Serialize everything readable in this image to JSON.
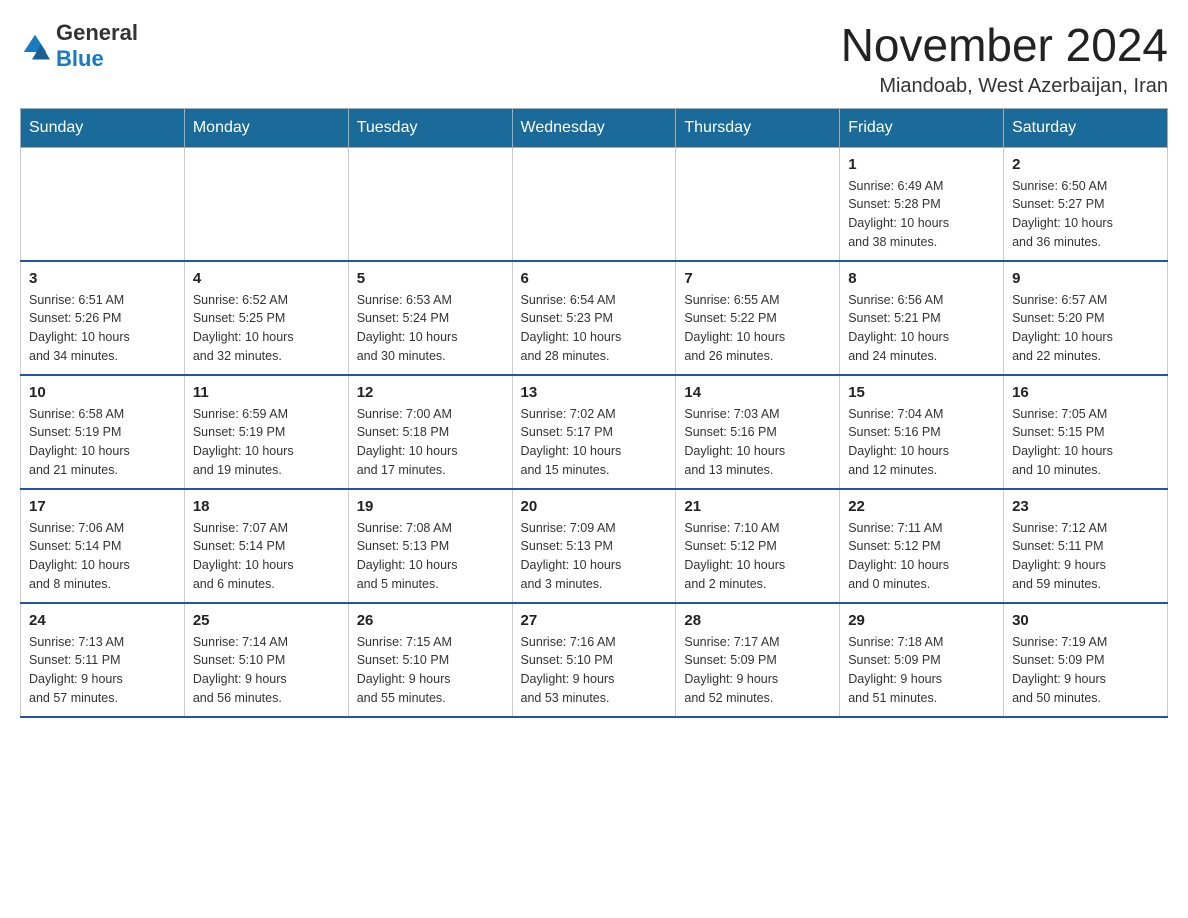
{
  "logo": {
    "general": "General",
    "blue": "Blue"
  },
  "title": "November 2024",
  "location": "Miandoab, West Azerbaijan, Iran",
  "weekdays": [
    "Sunday",
    "Monday",
    "Tuesday",
    "Wednesday",
    "Thursday",
    "Friday",
    "Saturday"
  ],
  "weeks": [
    [
      {
        "day": "",
        "info": ""
      },
      {
        "day": "",
        "info": ""
      },
      {
        "day": "",
        "info": ""
      },
      {
        "day": "",
        "info": ""
      },
      {
        "day": "",
        "info": ""
      },
      {
        "day": "1",
        "info": "Sunrise: 6:49 AM\nSunset: 5:28 PM\nDaylight: 10 hours\nand 38 minutes."
      },
      {
        "day": "2",
        "info": "Sunrise: 6:50 AM\nSunset: 5:27 PM\nDaylight: 10 hours\nand 36 minutes."
      }
    ],
    [
      {
        "day": "3",
        "info": "Sunrise: 6:51 AM\nSunset: 5:26 PM\nDaylight: 10 hours\nand 34 minutes."
      },
      {
        "day": "4",
        "info": "Sunrise: 6:52 AM\nSunset: 5:25 PM\nDaylight: 10 hours\nand 32 minutes."
      },
      {
        "day": "5",
        "info": "Sunrise: 6:53 AM\nSunset: 5:24 PM\nDaylight: 10 hours\nand 30 minutes."
      },
      {
        "day": "6",
        "info": "Sunrise: 6:54 AM\nSunset: 5:23 PM\nDaylight: 10 hours\nand 28 minutes."
      },
      {
        "day": "7",
        "info": "Sunrise: 6:55 AM\nSunset: 5:22 PM\nDaylight: 10 hours\nand 26 minutes."
      },
      {
        "day": "8",
        "info": "Sunrise: 6:56 AM\nSunset: 5:21 PM\nDaylight: 10 hours\nand 24 minutes."
      },
      {
        "day": "9",
        "info": "Sunrise: 6:57 AM\nSunset: 5:20 PM\nDaylight: 10 hours\nand 22 minutes."
      }
    ],
    [
      {
        "day": "10",
        "info": "Sunrise: 6:58 AM\nSunset: 5:19 PM\nDaylight: 10 hours\nand 21 minutes."
      },
      {
        "day": "11",
        "info": "Sunrise: 6:59 AM\nSunset: 5:19 PM\nDaylight: 10 hours\nand 19 minutes."
      },
      {
        "day": "12",
        "info": "Sunrise: 7:00 AM\nSunset: 5:18 PM\nDaylight: 10 hours\nand 17 minutes."
      },
      {
        "day": "13",
        "info": "Sunrise: 7:02 AM\nSunset: 5:17 PM\nDaylight: 10 hours\nand 15 minutes."
      },
      {
        "day": "14",
        "info": "Sunrise: 7:03 AM\nSunset: 5:16 PM\nDaylight: 10 hours\nand 13 minutes."
      },
      {
        "day": "15",
        "info": "Sunrise: 7:04 AM\nSunset: 5:16 PM\nDaylight: 10 hours\nand 12 minutes."
      },
      {
        "day": "16",
        "info": "Sunrise: 7:05 AM\nSunset: 5:15 PM\nDaylight: 10 hours\nand 10 minutes."
      }
    ],
    [
      {
        "day": "17",
        "info": "Sunrise: 7:06 AM\nSunset: 5:14 PM\nDaylight: 10 hours\nand 8 minutes."
      },
      {
        "day": "18",
        "info": "Sunrise: 7:07 AM\nSunset: 5:14 PM\nDaylight: 10 hours\nand 6 minutes."
      },
      {
        "day": "19",
        "info": "Sunrise: 7:08 AM\nSunset: 5:13 PM\nDaylight: 10 hours\nand 5 minutes."
      },
      {
        "day": "20",
        "info": "Sunrise: 7:09 AM\nSunset: 5:13 PM\nDaylight: 10 hours\nand 3 minutes."
      },
      {
        "day": "21",
        "info": "Sunrise: 7:10 AM\nSunset: 5:12 PM\nDaylight: 10 hours\nand 2 minutes."
      },
      {
        "day": "22",
        "info": "Sunrise: 7:11 AM\nSunset: 5:12 PM\nDaylight: 10 hours\nand 0 minutes."
      },
      {
        "day": "23",
        "info": "Sunrise: 7:12 AM\nSunset: 5:11 PM\nDaylight: 9 hours\nand 59 minutes."
      }
    ],
    [
      {
        "day": "24",
        "info": "Sunrise: 7:13 AM\nSunset: 5:11 PM\nDaylight: 9 hours\nand 57 minutes."
      },
      {
        "day": "25",
        "info": "Sunrise: 7:14 AM\nSunset: 5:10 PM\nDaylight: 9 hours\nand 56 minutes."
      },
      {
        "day": "26",
        "info": "Sunrise: 7:15 AM\nSunset: 5:10 PM\nDaylight: 9 hours\nand 55 minutes."
      },
      {
        "day": "27",
        "info": "Sunrise: 7:16 AM\nSunset: 5:10 PM\nDaylight: 9 hours\nand 53 minutes."
      },
      {
        "day": "28",
        "info": "Sunrise: 7:17 AM\nSunset: 5:09 PM\nDaylight: 9 hours\nand 52 minutes."
      },
      {
        "day": "29",
        "info": "Sunrise: 7:18 AM\nSunset: 5:09 PM\nDaylight: 9 hours\nand 51 minutes."
      },
      {
        "day": "30",
        "info": "Sunrise: 7:19 AM\nSunset: 5:09 PM\nDaylight: 9 hours\nand 50 minutes."
      }
    ]
  ]
}
